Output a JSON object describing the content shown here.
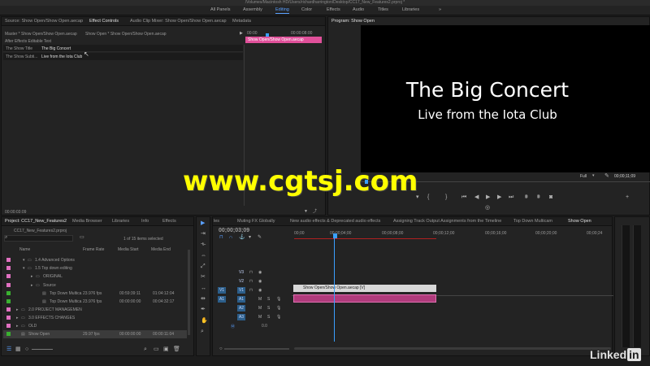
{
  "window": {
    "title": "/Volumes/Macintosh HD/Users/richardharrington/Desktop/CC17_New_Features2.prproj *"
  },
  "workspaces": [
    {
      "label": "All Panels"
    },
    {
      "label": "Assembly"
    },
    {
      "label": "Editing"
    },
    {
      "label": "Color"
    },
    {
      "label": "Effects"
    },
    {
      "label": "Audio"
    },
    {
      "label": "Titles"
    },
    {
      "label": "Libraries"
    }
  ],
  "source_panel": {
    "tabs": [
      "Source: Show Open/Show Open.aecap",
      "Effect Controls",
      "Audio Clip Mixer: Show Open/Show Open.aecap",
      "Metadata"
    ],
    "master_label": "Master * Show Open/Show Open.aecap",
    "clip_label": "Show Open * Show Open/Show Open.aecap",
    "section": "After Effects Editable Text",
    "params": [
      {
        "name": "The Show Title",
        "value": "The Big Concert"
      },
      {
        "name": "The Show Subti...",
        "value": "Live from the Iota Club"
      }
    ],
    "ruler_start": "00:00",
    "ruler_mark": "00:00:08:00",
    "clip_bar": "Show Open/Show Open.aecap",
    "timecode": "00:00:03:09"
  },
  "program_panel": {
    "tab": "Program: Show Open",
    "title_text": "The Big Concert",
    "subtitle_text": "Live from the Iota Club",
    "fit": "Full",
    "timecode": "00;00;11;09"
  },
  "watermark": "www.cgtsj.com",
  "project_panel": {
    "tabs": [
      "Project: CC17_New_Features2",
      "Media Browser",
      "Libraries",
      "Info",
      "Effects"
    ],
    "file": "CC17_New_Features2.prproj",
    "count": "1 of 15 items selected",
    "columns": [
      "Name",
      "Frame Rate",
      "Media Start",
      "Media End"
    ],
    "rows": [
      {
        "name": "1.4 Advanced Options",
        "rate": "",
        "start": "",
        "end": "",
        "color": "#e070c0"
      },
      {
        "name": "1.5 Top down editing",
        "rate": "",
        "start": "",
        "end": "",
        "color": "#e070c0"
      },
      {
        "name": "ORIGINAL",
        "rate": "",
        "start": "",
        "end": "",
        "color": "#e070c0"
      },
      {
        "name": "Source",
        "rate": "",
        "start": "",
        "end": "",
        "color": "#e070c0"
      },
      {
        "name": "Top Down Multica",
        "rate": "23.976 fps",
        "start": "00:59:39:11",
        "end": "01:04:12:04",
        "color": "#3ab030"
      },
      {
        "name": "Top Down Multica",
        "rate": "23.976 fps",
        "start": "00:00:00:00",
        "end": "00:04:32:17",
        "color": "#3ab030"
      },
      {
        "name": "2.0 PROJECT MANAGEMEN",
        "rate": "",
        "start": "",
        "end": "",
        "color": "#e070c0"
      },
      {
        "name": "3.0 EFFECTS CHANGES",
        "rate": "",
        "start": "",
        "end": "",
        "color": "#e070c0"
      },
      {
        "name": "OLD",
        "rate": "",
        "start": "",
        "end": "",
        "color": "#e070c0"
      },
      {
        "name": "Show Open",
        "rate": "29.97 fps",
        "start": "00:00:00:00",
        "end": "00:00:11:04",
        "color": "#3ab030"
      }
    ]
  },
  "timeline_panel": {
    "tabs": [
      "les",
      "Muting FX Globally",
      "New audio effects & Deprecated audio effects",
      "Assigning Track Output Assignments from the Timeline",
      "Top Down Multicam",
      "Show Open"
    ],
    "timecode": "00;00;03;09",
    "ruler": [
      "00;00",
      "00;00;04;00",
      "00;00;08;00",
      "00;00;12;00",
      "00;00;16;00",
      "00;00;20;00",
      "00;00;24"
    ],
    "video_tracks": [
      "V3",
      "V2",
      "V1"
    ],
    "audio_tracks": [
      "A1",
      "A2",
      "A3"
    ],
    "src_video": "V1",
    "src_audio": "A1",
    "master_vol": "0.0",
    "clip_label": "Show Open/Show Open.aecap [V]"
  },
  "branding": {
    "text": "Linked",
    "in": "in"
  }
}
